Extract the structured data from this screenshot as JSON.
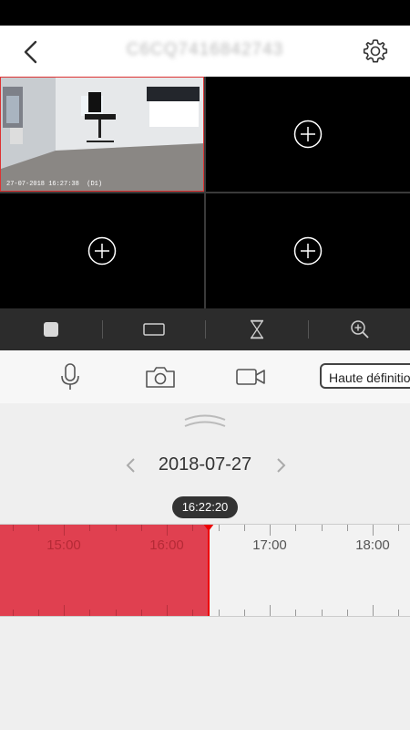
{
  "header": {
    "title": "C6CQ7416842743",
    "back_icon": "chevron-left-icon",
    "settings_icon": "gear-icon"
  },
  "camera_grid": {
    "active_camera": {
      "timestamp": "27-07-2018 16:27:38",
      "label": "D1"
    },
    "empty_slots": [
      {
        "icon": "plus-circle-icon"
      },
      {
        "icon": "plus-circle-icon"
      },
      {
        "icon": "plus-circle-icon"
      }
    ]
  },
  "view_toolbar": {
    "items": [
      {
        "icon": "stop-square-icon"
      },
      {
        "icon": "single-view-rect-icon"
      },
      {
        "icon": "hourglass-icon"
      },
      {
        "icon": "zoom-in-icon"
      }
    ]
  },
  "actions": {
    "mic_icon": "microphone-icon",
    "camera_icon": "snapshot-camera-icon",
    "video_icon": "record-video-icon",
    "quality_label": "Haute définition"
  },
  "playback": {
    "date": "2018-07-27",
    "current_time": "16:22:20",
    "hours": [
      "15:00",
      "16:00",
      "17:00",
      "18:00"
    ],
    "recorded_fraction_of_view": 0.51
  },
  "colors": {
    "accent_red": "#e04050",
    "cursor_red": "#ee0000",
    "toolbar_bg": "#2c2c2c"
  }
}
